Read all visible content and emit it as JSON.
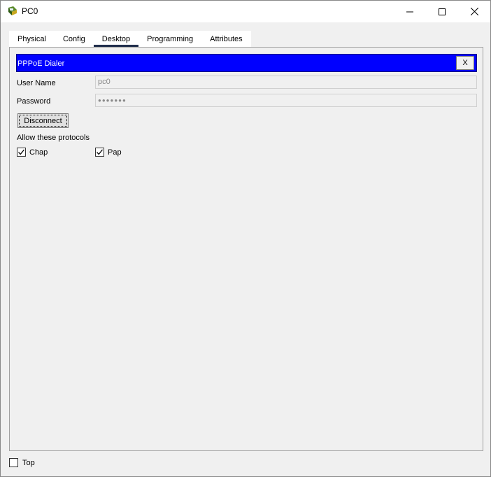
{
  "window": {
    "title": "PC0"
  },
  "tabs": [
    {
      "label": "Physical",
      "active": false
    },
    {
      "label": "Config",
      "active": false
    },
    {
      "label": "Desktop",
      "active": true
    },
    {
      "label": "Programming",
      "active": false
    },
    {
      "label": "Attributes",
      "active": false
    }
  ],
  "dialer": {
    "title": "PPPoE Dialer",
    "close_label": "X",
    "username_label": "User Name",
    "username_value": "pc0",
    "password_label": "Password",
    "password_value": "●●●●●●●",
    "disconnect_label": "Disconnect",
    "protocols_label": "Allow these protocols",
    "protocols": [
      {
        "label": "Chap",
        "checked": true
      },
      {
        "label": "Pap",
        "checked": true
      }
    ]
  },
  "footer": {
    "top_label": "Top",
    "top_checked": false
  },
  "colors": {
    "header_bg": "#0000ff",
    "header_text": "#ffffff",
    "active_tab_underline": "#1f2d4b"
  },
  "icons": {
    "app": "packet-tracer-pc-icon",
    "minimize": "minimize-icon",
    "maximize": "maximize-icon",
    "close": "close-icon",
    "checkmark": "checkmark-icon"
  }
}
